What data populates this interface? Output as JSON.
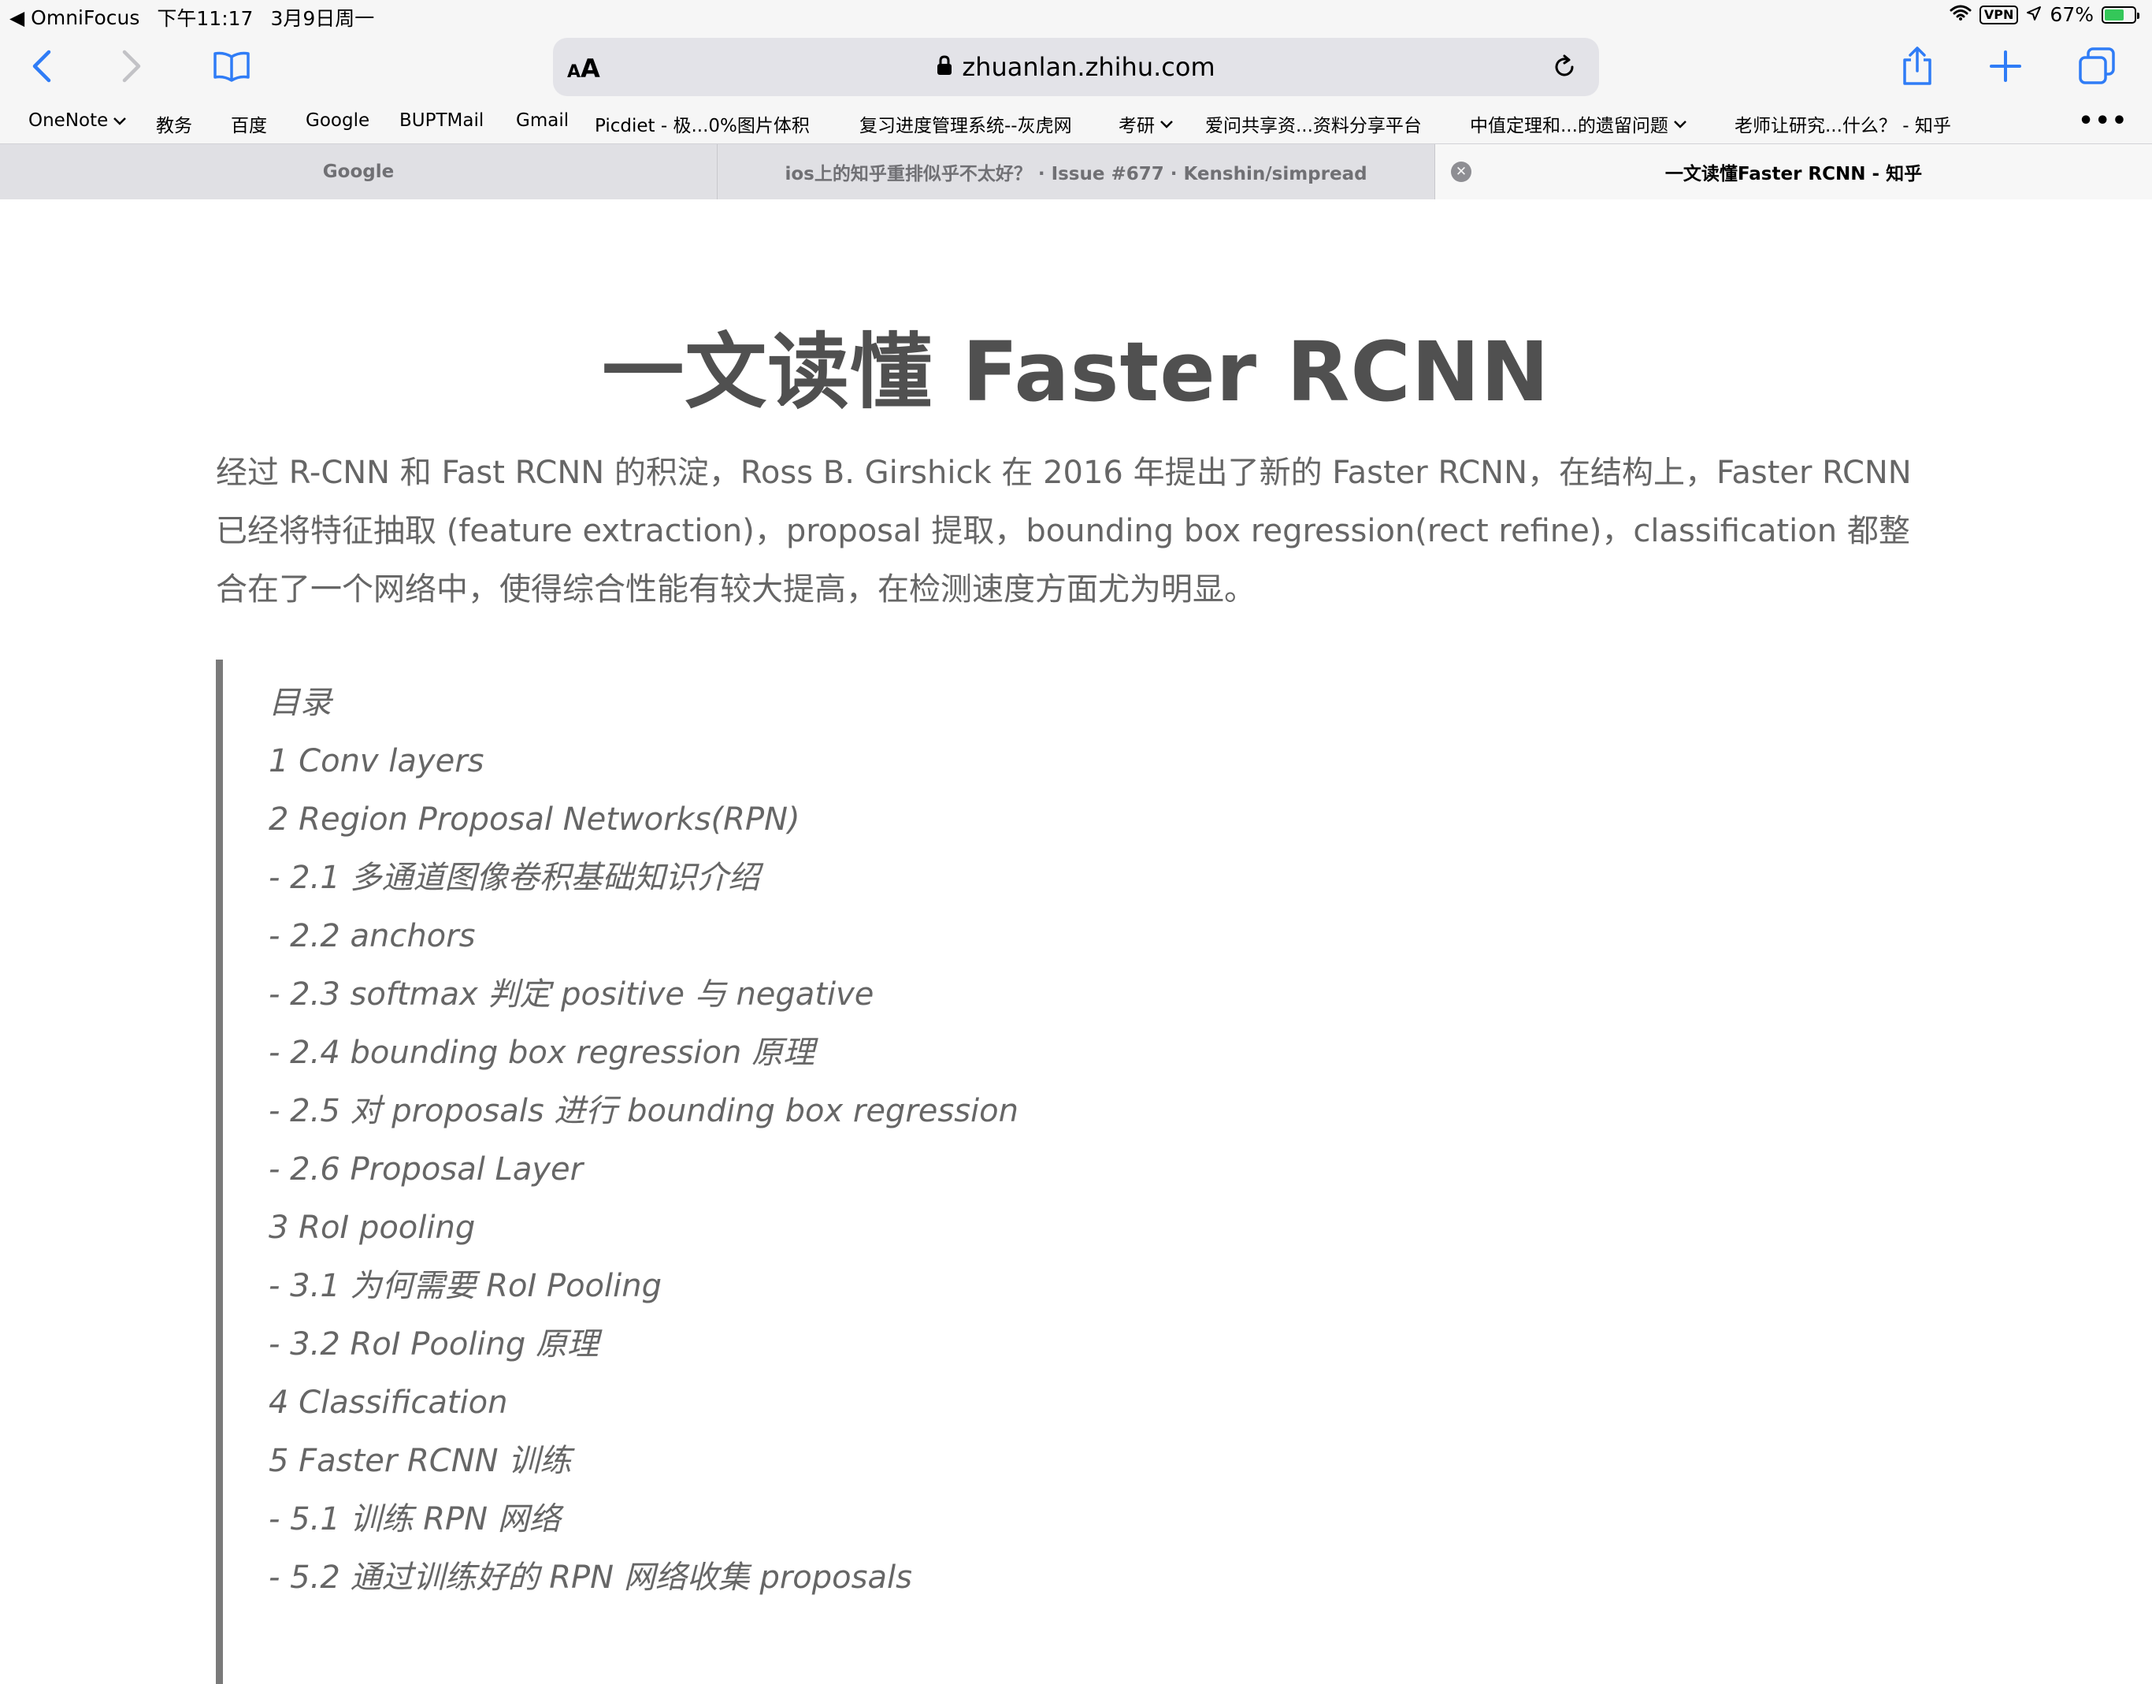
{
  "status_bar": {
    "back_app": "◀ OmniFocus",
    "time": "下午11:17",
    "date": "3月9日周一",
    "vpn": "VPN",
    "battery": "67%",
    "battery_level": 0.67
  },
  "toolbar": {
    "url": "zhuanlan.zhihu.com",
    "aa_small": "A",
    "aa_large": "A"
  },
  "bookmarks": [
    {
      "label": "OneNote",
      "folder": true
    },
    {
      "label": "教务",
      "folder": false
    },
    {
      "label": "百度",
      "folder": false
    },
    {
      "label": "Google",
      "folder": false
    },
    {
      "label": "BUPTMail",
      "folder": false
    },
    {
      "label": "Gmail",
      "folder": false
    },
    {
      "label": "Picdiet - 极...0%图片体积",
      "folder": false
    },
    {
      "label": "复习进度管理系统--灰虎网",
      "folder": false
    },
    {
      "label": "考研",
      "folder": true
    },
    {
      "label": "爱问共享资...资料分享平台",
      "folder": false
    },
    {
      "label": "中值定理和...的遗留问题",
      "folder": true
    },
    {
      "label": "老师让研究...什么？ - 知乎",
      "folder": false
    }
  ],
  "tabs": [
    {
      "title": "Google",
      "active": false
    },
    {
      "title": "ios上的知乎重排似乎不太好？ · Issue #677 · Kenshin/simpread",
      "active": false
    },
    {
      "title": "一文读懂Faster RCNN - 知乎",
      "active": true
    }
  ],
  "article": {
    "title": "一文读懂 Faster RCNN",
    "intro": "经过 R-CNN 和 Fast RCNN 的积淀，Ross B. Girshick 在 2016 年提出了新的 Faster RCNN，在结构上，Faster RCNN 已经将特征抽取 (feature extraction)，proposal 提取，bounding box regression(rect refine)，classification 都整合在了一个网络中，使得综合性能有较大提高，在检测速度方面尤为明显。",
    "toc": [
      "目录",
      "1 Conv layers",
      "2 Region Proposal Networks(RPN)",
      "- 2.1 多通道图像卷积基础知识介绍",
      "- 2.2 anchors",
      "- 2.3 softmax 判定 positive 与 negative",
      "- 2.4 bounding box regression 原理",
      "- 2.5 对 proposals 进行 bounding box regression",
      "- 2.6 Proposal Layer",
      "3 RoI pooling",
      "- 3.1 为何需要 RoI Pooling",
      "- 3.2 RoI Pooling 原理",
      "4 Classification",
      "5 Faster RCNN 训练",
      "- 5.1 训练 RPN 网络",
      "- 5.2 通过训练好的 RPN 网络收集 proposals"
    ]
  }
}
